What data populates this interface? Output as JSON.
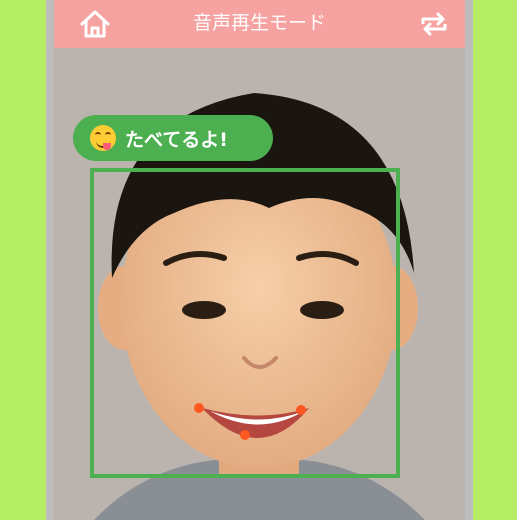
{
  "header": {
    "title": "音声再生モード",
    "home_icon": "home-icon",
    "refresh_icon": "refresh-icon"
  },
  "status_bubble": {
    "emoji": "face-savoring-food-emoji",
    "text": "たべてるよ!"
  },
  "colors": {
    "background": "#b4ec63",
    "header": "#f6a2a0",
    "accent": "#4caf50",
    "landmark": "#ff5722"
  },
  "detection": {
    "face_detected": true,
    "mouth_landmark_count": 3
  }
}
